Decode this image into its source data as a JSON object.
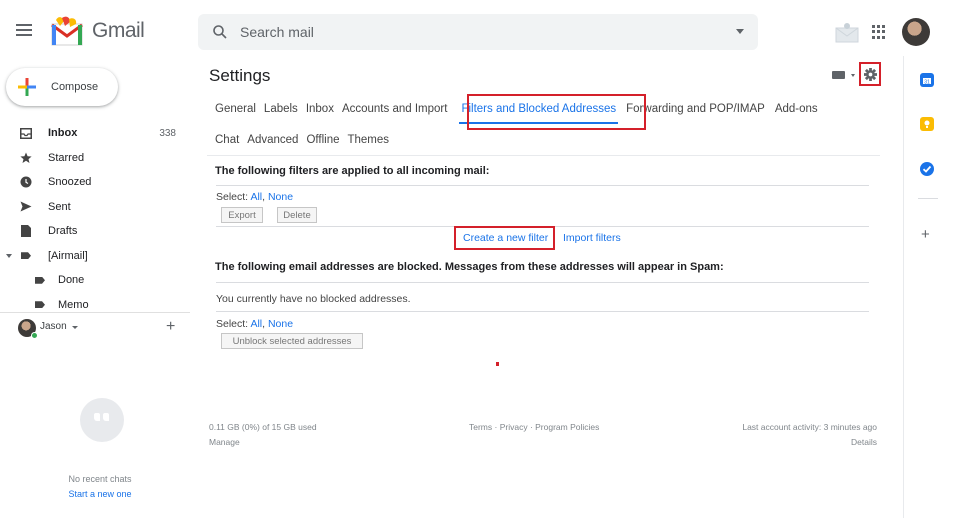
{
  "header": {
    "logo_text": "Gmail",
    "search_placeholder": "Search mail"
  },
  "compose": {
    "label": "Compose"
  },
  "nav": {
    "items": [
      {
        "label": "Inbox",
        "count": "338",
        "icon": "inbox-icon"
      },
      {
        "label": "Starred",
        "icon": "star-icon"
      },
      {
        "label": "Snoozed",
        "icon": "clock-icon"
      },
      {
        "label": "Sent",
        "icon": "send-icon"
      },
      {
        "label": "Drafts",
        "icon": "draft-icon"
      },
      {
        "label": "[Airmail]",
        "icon": "label-icon"
      },
      {
        "label": "Done",
        "icon": "label-icon"
      },
      {
        "label": "Memo",
        "icon": "label-icon"
      }
    ]
  },
  "user": {
    "name": "Jason",
    "add": "+"
  },
  "chat": {
    "no_chats": "No recent chats",
    "start": "Start a new one"
  },
  "settings": {
    "title": "Settings",
    "tabs_row1": [
      "General",
      "Labels",
      "Inbox",
      "Accounts and Import",
      "Filters and Blocked Addresses",
      "Forwarding and POP/IMAP",
      "Add-ons"
    ],
    "tabs_row2": [
      "Chat",
      "Advanced",
      "Offline",
      "Themes"
    ],
    "active_tab": "Filters and Blocked Addresses",
    "filters_heading": "The following filters are applied to all incoming mail:",
    "select_label": "Select:",
    "select_all": "All",
    "select_sep": ",",
    "select_none": "None",
    "export_button": "Export",
    "delete_button": "Delete",
    "create_filter": "Create a new filter",
    "import_filters": "Import filters",
    "blocked_heading": "The following email addresses are blocked. Messages from these addresses will appear in Spam:",
    "no_blocked": "You currently have no blocked addresses.",
    "unblock_button": "Unblock selected addresses"
  },
  "footer": {
    "storage": "0.11 GB (0%) of 15 GB used",
    "manage": "Manage",
    "terms": "Terms",
    "sep": " · ",
    "privacy": "Privacy",
    "policies": "Program Policies",
    "activity": "Last account activity: 3 minutes ago",
    "details": "Details"
  },
  "colors": {
    "accent": "#1a73e8",
    "highlight_box": "#d4202a"
  }
}
